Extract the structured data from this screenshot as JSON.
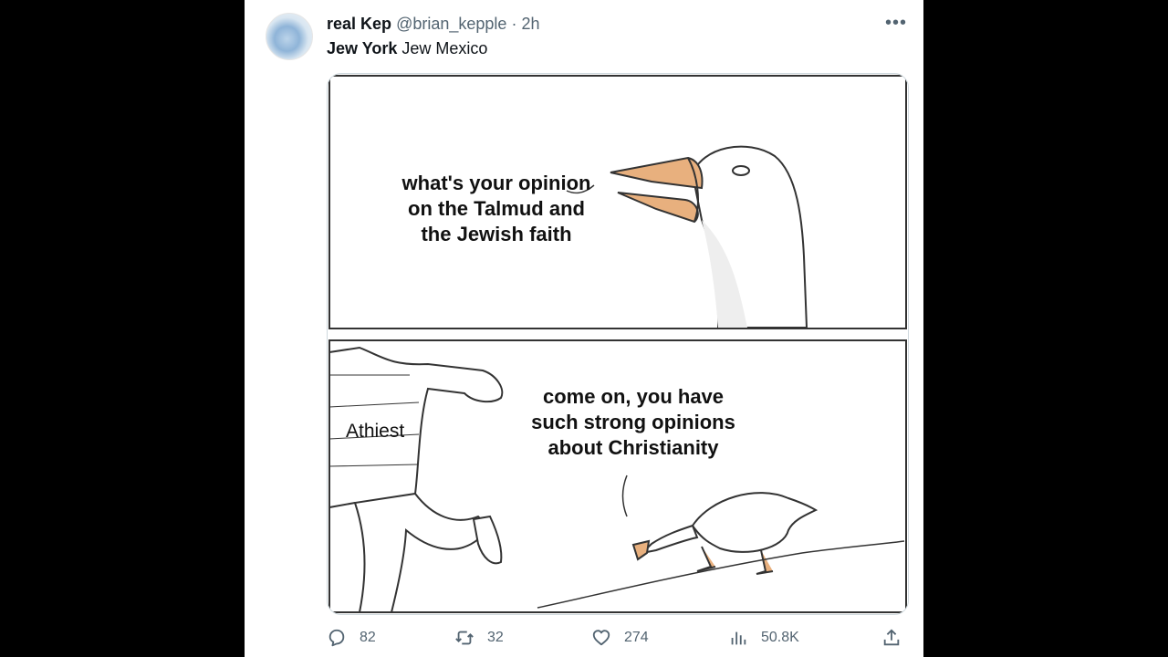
{
  "author": {
    "display_name": "real Kep",
    "handle": "@brian_kepple",
    "separator": "·",
    "time": "2h"
  },
  "tweet": {
    "text_bold": "Jew York",
    "text_rest": " Jew Mexico"
  },
  "meme": {
    "panel1_line1": "what's your opinion",
    "panel1_line2": "on the Talmud and",
    "panel1_line3": "the Jewish faith",
    "panel2_line1": "come on, you have",
    "panel2_line2": "such strong opinions",
    "panel2_line3": "about Christianity",
    "person_label": "Athiest"
  },
  "actions": {
    "replies": "82",
    "reposts": "32",
    "likes": "274",
    "views": "50.8K"
  },
  "colors": {
    "text_primary": "#0f1419",
    "text_secondary": "#536471",
    "beak": "#e8b07e"
  }
}
